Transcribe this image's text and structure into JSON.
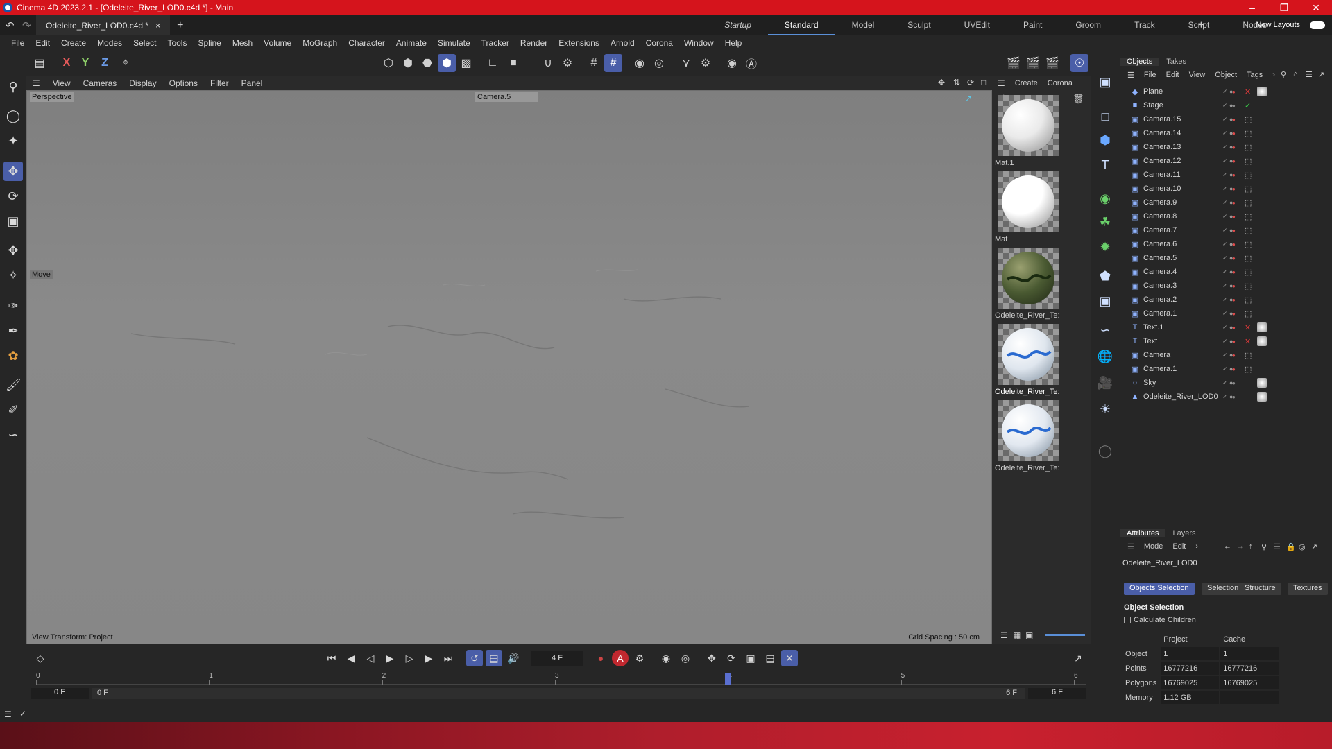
{
  "window": {
    "title": "Cinema 4D 2023.2.1 - [Odeleite_River_LOD0.c4d *] - Main"
  },
  "doc_tab": {
    "label": "Odeleite_River_LOD0.c4d *"
  },
  "layouts": [
    "Startup",
    "Standard",
    "Model",
    "Sculpt",
    "UVEdit",
    "Paint",
    "Groom",
    "Track",
    "Script",
    "Nodes"
  ],
  "new_layouts": "New Layouts",
  "menu": [
    "File",
    "Edit",
    "Create",
    "Modes",
    "Select",
    "Tools",
    "Spline",
    "Mesh",
    "Volume",
    "MoGraph",
    "Character",
    "Animate",
    "Simulate",
    "Tracker",
    "Render",
    "Extensions",
    "Arnold",
    "Corona",
    "Window",
    "Help"
  ],
  "axis_labels": {
    "x": "X",
    "y": "Y",
    "z": "Z"
  },
  "viewport": {
    "menu": [
      "View",
      "Cameras",
      "Display",
      "Options",
      "Filter",
      "Panel"
    ],
    "projection": "Perspective",
    "camera": "Camera.5",
    "tool": "Move",
    "view_transform": "View Transform: Project",
    "grid_spacing": "Grid Spacing : 50 cm"
  },
  "materials": {
    "menu": [
      "Create",
      "Corona"
    ],
    "items": [
      {
        "name": "Mat.1",
        "color": "#eaeaea"
      },
      {
        "name": "Mat",
        "color": "#ffffff"
      },
      {
        "name": "Odeleite_River_Te:",
        "color": "#4a5a32"
      },
      {
        "name": "Odeleite_River_Te:",
        "color": "#dfe6ee",
        "selected": true
      },
      {
        "name": "Odeleite_River_Te:",
        "color": "#e2e8f0"
      }
    ]
  },
  "objects": {
    "tabs": [
      "Objects",
      "Takes"
    ],
    "menu": [
      "File",
      "Edit",
      "View",
      "Object",
      "Tags"
    ],
    "items": [
      {
        "name": "Plane",
        "icon": "plane-icon"
      },
      {
        "name": "Stage",
        "icon": "stage-icon"
      },
      {
        "name": "Camera.15",
        "icon": "camera-icon"
      },
      {
        "name": "Camera.14",
        "icon": "camera-icon"
      },
      {
        "name": "Camera.13",
        "icon": "camera-icon"
      },
      {
        "name": "Camera.12",
        "icon": "camera-icon"
      },
      {
        "name": "Camera.11",
        "icon": "camera-icon"
      },
      {
        "name": "Camera.10",
        "icon": "camera-icon"
      },
      {
        "name": "Camera.9",
        "icon": "camera-icon"
      },
      {
        "name": "Camera.8",
        "icon": "camera-icon"
      },
      {
        "name": "Camera.7",
        "icon": "camera-icon"
      },
      {
        "name": "Camera.6",
        "icon": "camera-icon"
      },
      {
        "name": "Camera.5",
        "icon": "camera-icon"
      },
      {
        "name": "Camera.4",
        "icon": "camera-icon"
      },
      {
        "name": "Camera.3",
        "icon": "camera-icon"
      },
      {
        "name": "Camera.2",
        "icon": "camera-icon"
      },
      {
        "name": "Camera.1",
        "icon": "camera-icon"
      },
      {
        "name": "Text.1",
        "icon": "text-icon"
      },
      {
        "name": "Text",
        "icon": "text-icon"
      },
      {
        "name": "Camera",
        "icon": "camera-icon"
      },
      {
        "name": "Camera.1",
        "icon": "camera-icon"
      },
      {
        "name": "Sky",
        "icon": "sky-icon"
      },
      {
        "name": "Odeleite_River_LOD0",
        "icon": "mesh-icon"
      }
    ]
  },
  "attributes": {
    "tabs": [
      "Attributes",
      "Layers"
    ],
    "menu": [
      "Mode",
      "Edit"
    ],
    "object_name": "Odeleite_River_LOD0",
    "subtabs": [
      "Objects Selection",
      "Selection",
      "Structure",
      "Textures"
    ],
    "section": "Object Selection",
    "calc_children": "Calculate Children",
    "columns": [
      "Project",
      "Cache"
    ],
    "rows": [
      {
        "label": "Object",
        "project": "1",
        "cache": "1"
      },
      {
        "label": "Points",
        "project": "16777216",
        "cache": "16777216"
      },
      {
        "label": "Polygons",
        "project": "16769025",
        "cache": "16769025"
      },
      {
        "label": "Memory",
        "project": "1.12 GB",
        "cache": ""
      }
    ]
  },
  "timeline": {
    "current_frame": "4 F",
    "ruler": [
      "0",
      "1",
      "2",
      "3",
      "4",
      "5",
      "6"
    ],
    "start": "0 F",
    "min": "0 F",
    "max": "6 F",
    "end": "6 F",
    "playhead_frame": 4
  }
}
